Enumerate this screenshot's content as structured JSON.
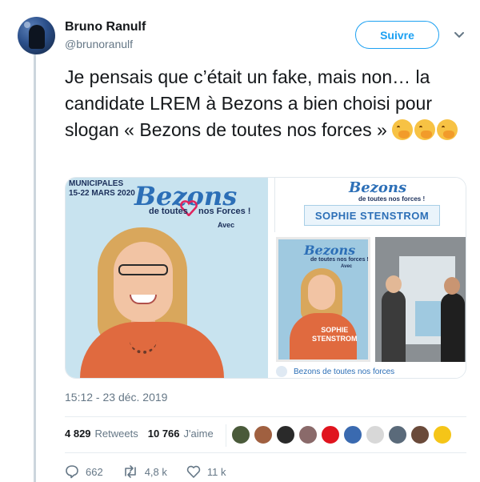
{
  "user": {
    "name": "Bruno Ranulf",
    "handle": "@brunoranulf"
  },
  "header": {
    "follow_label": "Suivre",
    "menu_icon": "chevron-down-icon"
  },
  "tweet": {
    "text": "Je pensais que c’était un fake, mais non… la candidate LREM à Bezons a bien choisi pour slogan « Bezons de toutes nos forces » ",
    "emoji_count": 3,
    "emoji_name": "face-with-hand-over-mouth"
  },
  "media": {
    "poster_left": {
      "campaign_line1": "MUNICIPALES",
      "campaign_line2": "15-22 MARS 2020",
      "logo": "Bezons",
      "slogan_left": "de toutes",
      "slogan_right": "nos Forces !",
      "avec": "Avec"
    },
    "banner": {
      "logo": "Bezons",
      "slogan": "de toutes nos forces !",
      "candidate": "SOPHIE STENSTROM"
    },
    "poster_small": {
      "logo": "Bezons",
      "slogan": "de toutes nos forces !",
      "avec": "Avec",
      "name_line1": "SOPHIE",
      "name_line2": "STENSTROM"
    },
    "caption": "Bezons de toutes nos forces"
  },
  "timestamp": "15:12 - 23 déc. 2019",
  "stats": {
    "retweets_count": "4 829",
    "retweets_label": "Retweets",
    "likes_count": "10 766",
    "likes_label": "J'aime"
  },
  "actions": {
    "replies": "662",
    "retweets": "4,8 k",
    "likes": "11 k"
  },
  "colors": {
    "accent": "#1da1f2",
    "text": "#14171a",
    "secondary": "#657786",
    "logo_blue": "#2c6fb7",
    "heart_red": "#e0245e"
  }
}
